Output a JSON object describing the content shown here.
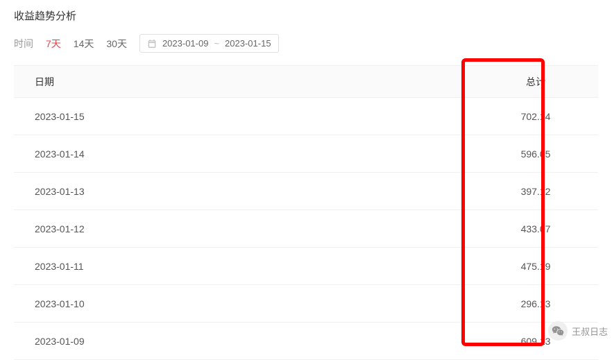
{
  "title": "收益趋势分析",
  "filter": {
    "label": "时间",
    "tabs": [
      "7天",
      "14天",
      "30天"
    ],
    "activeIndex": 0,
    "date_start": "2023-01-09",
    "date_sep": "~",
    "date_end": "2023-01-15"
  },
  "table": {
    "header": {
      "date": "日期",
      "total": "总计"
    },
    "rows": [
      {
        "date": "2023-01-15",
        "total": "702.14"
      },
      {
        "date": "2023-01-14",
        "total": "596.05"
      },
      {
        "date": "2023-01-13",
        "total": "397.12"
      },
      {
        "date": "2023-01-12",
        "total": "433.07"
      },
      {
        "date": "2023-01-11",
        "total": "475.19"
      },
      {
        "date": "2023-01-10",
        "total": "296.13"
      },
      {
        "date": "2023-01-09",
        "total": "609.13"
      }
    ]
  },
  "watermark": "王叔日志"
}
